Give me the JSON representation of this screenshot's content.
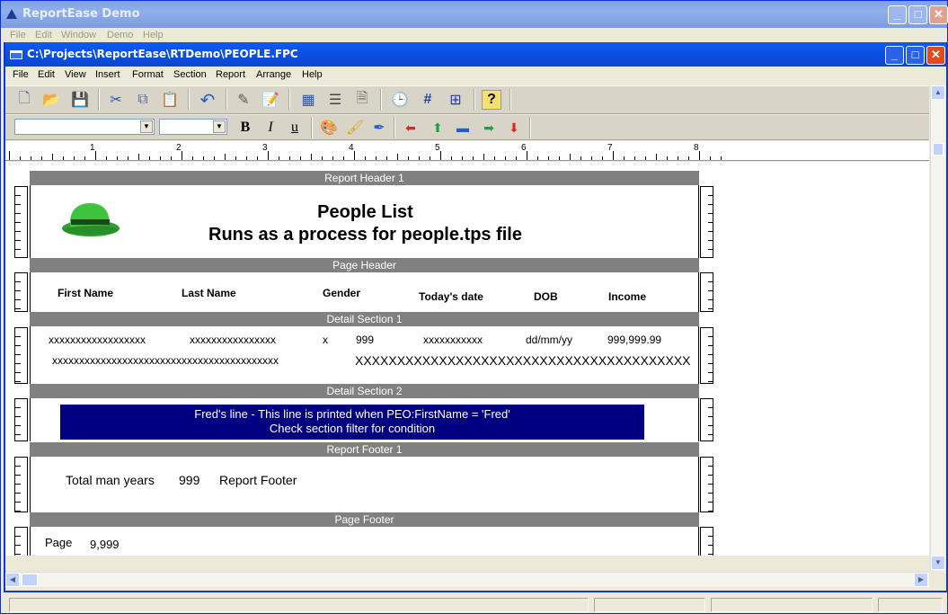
{
  "app": {
    "title": "ReportEase Demo",
    "menu": [
      "File",
      "Edit",
      "Window",
      "Demo",
      "Help"
    ]
  },
  "document": {
    "title": "C:\\Projects\\ReportEase\\RTDemo\\PEOPLE.FPC",
    "menu": [
      "File",
      "Edit",
      "View",
      "Insert",
      "Format",
      "Section",
      "Report",
      "Arrange",
      "Help"
    ]
  },
  "ruler": {
    "marks": [
      "1",
      "2",
      "3",
      "4",
      "5",
      "6",
      "7",
      "8"
    ]
  },
  "bands": {
    "report_header": "Report Header 1",
    "page_header": "Page Header",
    "detail1": "Detail Section 1",
    "detail2": "Detail Section 2",
    "report_footer": "Report Footer 1",
    "page_footer": "Page Footer"
  },
  "report_header": {
    "title": "People List",
    "subtitle": "Runs as a process for people.tps file"
  },
  "page_header": {
    "first_name": "First Name",
    "last_name": "Last Name",
    "gender": "Gender",
    "todays_date": "Today's date",
    "dob": "DOB",
    "income": "Income"
  },
  "detail1": {
    "first_name": "xxxxxxxxxxxxxxxxxx",
    "last_name": "xxxxxxxxxxxxxxxx",
    "gender": "x",
    "num": "999",
    "todays_date": "xxxxxxxxxxx",
    "dob": "dd/mm/yy",
    "income": "999,999.99",
    "line2_left": "xxxxxxxxxxxxxxxxxxxxxxxxxxxxxxxxxxxxxxxxxx",
    "line2_right": "XXXXXXXXXXXXXXXXXXXXXXXXXXXXXXXXXXXXXXXX"
  },
  "detail2": {
    "line1": "Fred's line - This line is printed when PEO:FirstName = 'Fred'",
    "line2": "Check section filter for condition"
  },
  "report_footer": {
    "label": "Total man years",
    "value": "999",
    "text": "Report Footer"
  },
  "page_footer": {
    "label": "Page",
    "value": "9,999"
  }
}
